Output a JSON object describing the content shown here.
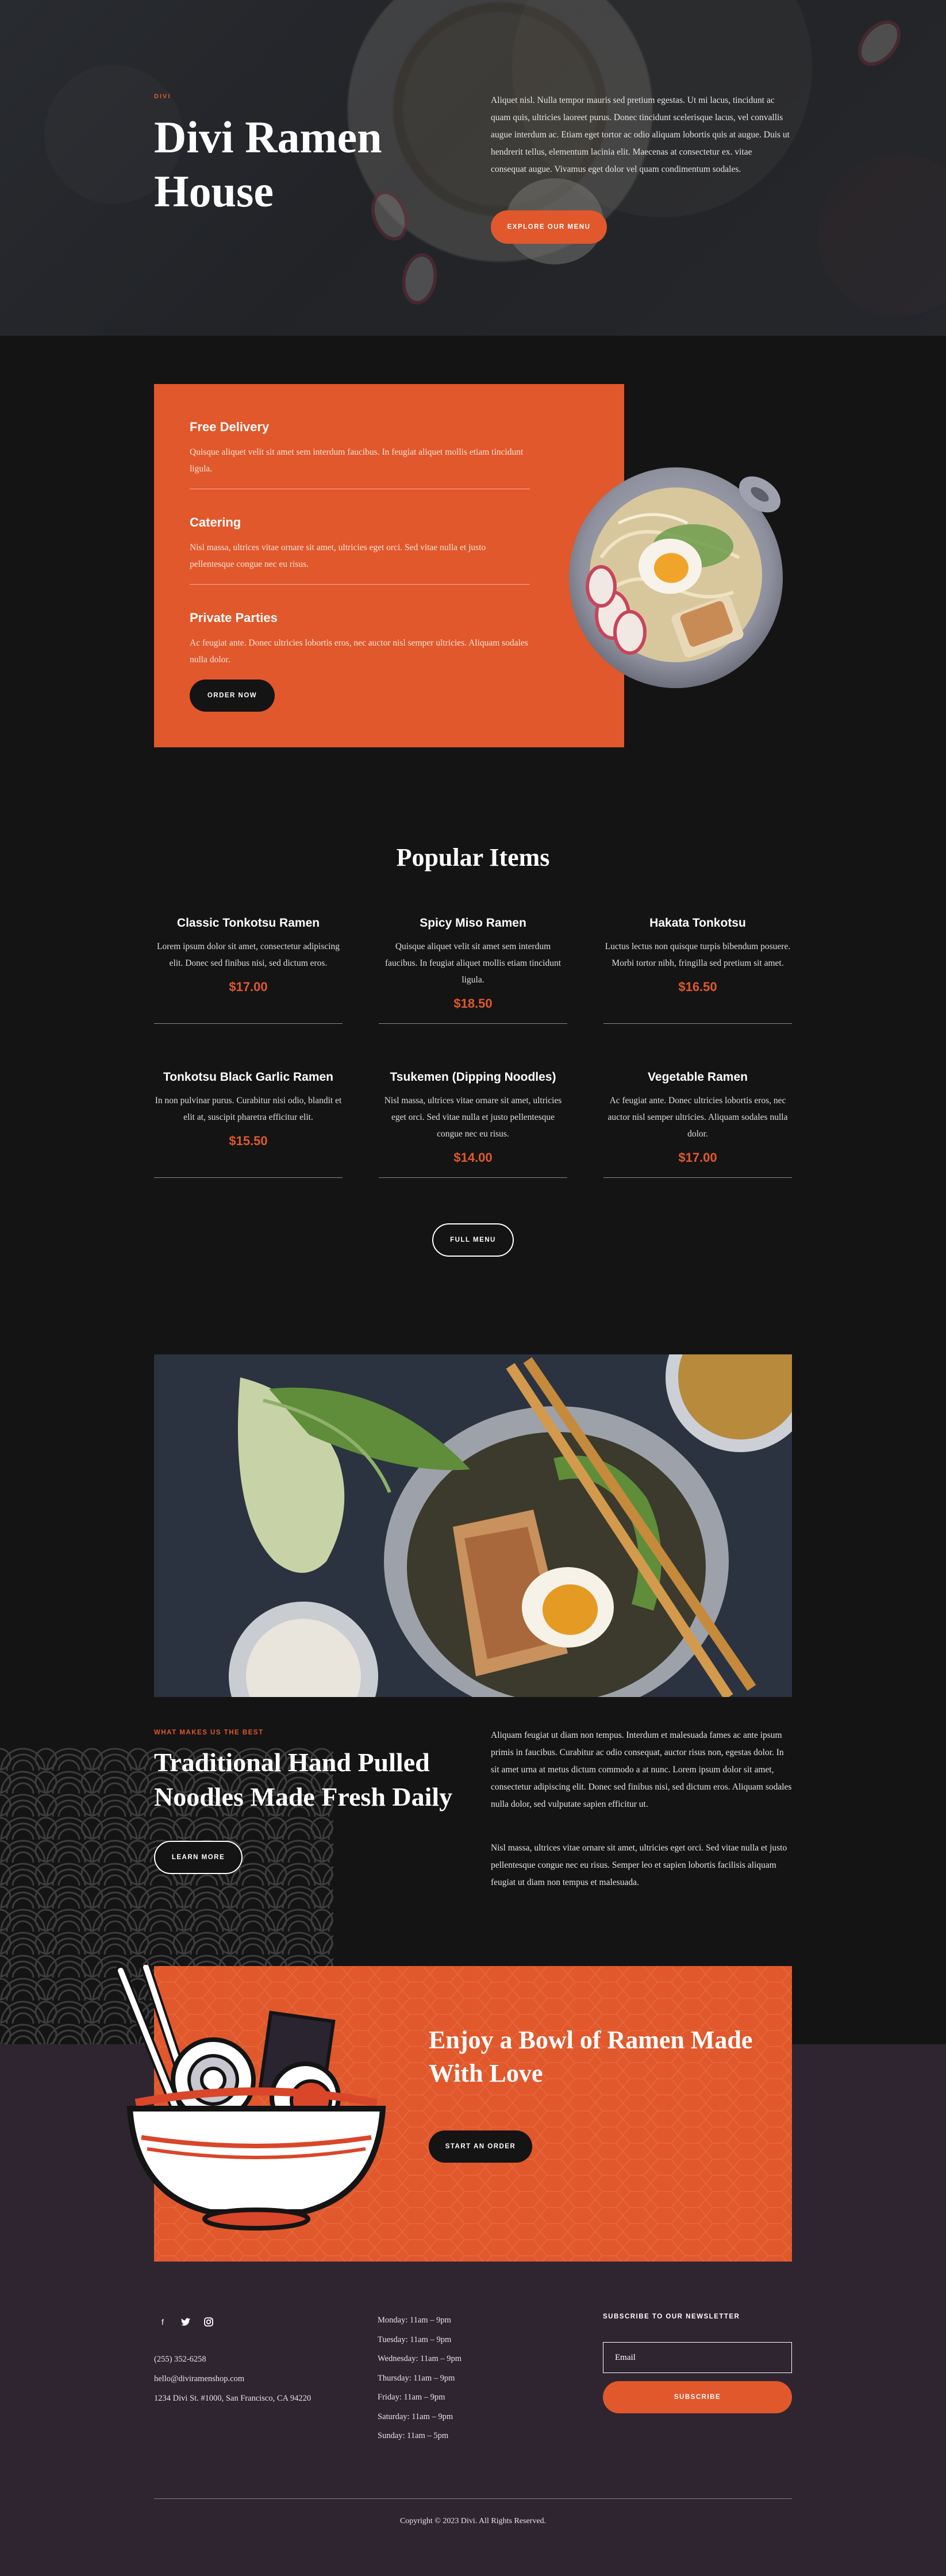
{
  "hero": {
    "eyebrow": "DIVI",
    "title": "Divi Ramen House",
    "text": "Aliquet nisl. Nulla tempor mauris sed pretium egestas. Ut mi lacus, tincidunt ac quam quis, ultricies laoreet purus. Donec tincidunt scelerisque lacus, vel convallis augue interdum ac. Etiam eget tortor ac odio aliquam lobortis quis at augue. Duis ut hendrerit tellus, elementum lacinia elit. Maecenas at consectetur ex. vitae consequat augue. Vivamus eget dolor vel quam condimentum sodales.",
    "button": "EXPLORE OUR MENU"
  },
  "services": {
    "items": [
      {
        "title": "Free Delivery",
        "text": "Quisque aliquet velit sit amet sem interdum faucibus. In feugiat aliquet mollis etiam tincidunt ligula."
      },
      {
        "title": "Catering",
        "text": "Nisl massa, ultrices vitae ornare sit amet, ultricies eget orci. Sed vitae nulla et justo pellentesque congue nec eu risus."
      },
      {
        "title": "Private Parties",
        "text": "Ac feugiat ante. Donec ultricies lobortis eros, nec auctor nisl semper ultricies. Aliquam sodales nulla dolor."
      }
    ],
    "button": "ORDER NOW"
  },
  "popular": {
    "title": "Popular Items",
    "items": [
      {
        "name": "Classic Tonkotsu Ramen",
        "desc": "Lorem ipsum dolor sit amet, consectetur adipiscing elit. Donec sed finibus nisi, sed dictum eros.",
        "price": "$17.00"
      },
      {
        "name": "Spicy Miso Ramen",
        "desc": "Quisque aliquet velit sit amet sem interdum faucibus. In feugiat aliquet mollis etiam tincidunt ligula.",
        "price": "$18.50"
      },
      {
        "name": "Hakata Tonkotsu",
        "desc": "Luctus lectus non quisque turpis bibendum posuere. Morbi tortor nibh, fringilla sed pretium sit amet.",
        "price": "$16.50"
      },
      {
        "name": "Tonkotsu Black Garlic Ramen",
        "desc": "In non pulvinar purus. Curabitur nisi odio, blandit et elit at, suscipit pharetra efficitur elit.",
        "price": "$15.50"
      },
      {
        "name": "Tsukemen (Dipping Noodles)",
        "desc": "Nisl massa, ultrices vitae ornare sit amet, ultricies eget orci. Sed vitae nulla et justo pellentesque congue nec eu risus.",
        "price": "$14.00"
      },
      {
        "name": "Vegetable Ramen",
        "desc": "Ac feugiat ante. Donec ultricies lobortis eros, nec auctor nisl semper ultricies. Aliquam sodales nulla dolor.",
        "price": "$17.00"
      }
    ],
    "button": "FULL MENU"
  },
  "why": {
    "eyebrow": "WHAT MAKES US THE BEST",
    "title": "Traditional Hand Pulled Noodles Made Fresh Daily",
    "button": "LEARN MORE",
    "paragraph1": "Aliquam feugiat ut diam non tempus. Interdum et malesuada fames ac ante ipsum primis in faucibus. Curabitur ac odio consequat, auctor risus non, egestas dolor. In sit amet urna at metus dictum commodo a at nunc. Lorem ipsum dolor sit amet, consectetur adipiscing elit. Donec sed finibus nisi, sed dictum eros. Aliquam sodales nulla dolor, sed vulputate sapien efficitur ut.",
    "paragraph2": "Nisl massa, ultrices vitae ornare sit amet, ultricies eget orci. Sed vitae nulla et justo pellentesque congue nec eu risus. Semper leo et sapien lobortis facilisis aliquam feugiat ut diam non tempus et malesuada."
  },
  "cta": {
    "title": "Enjoy a Bowl of Ramen Made With Love",
    "button": "START AN ORDER"
  },
  "footer": {
    "phone": "(255) 352-6258",
    "email": "hello@diviramenshop.com",
    "address": "1234 Divi St. #1000, San Francisco, CA 94220",
    "hours": [
      "Monday: 11am – 9pm",
      "Tuesday: 11am – 9pm",
      "Wednesday: 11am – 9pm",
      "Thursday: 11am – 9pm",
      "Friday: 11am – 9pm",
      "Saturday: 11am – 9pm",
      "Sunday: 11am – 5pm"
    ],
    "newsletter_title": "SUBSCRIBE TO OUR NEWSLETTER",
    "email_placeholder": "Email",
    "subscribe": "SUBSCRIBE",
    "copyright": "Copyright © 2023 Divi. All Rights Reserved.",
    "social_icons": [
      "facebook-icon",
      "twitter-icon",
      "instagram-icon"
    ]
  },
  "colors": {
    "accent": "#e0582c",
    "background": "#141414",
    "footer_bg": "#2f2530"
  }
}
